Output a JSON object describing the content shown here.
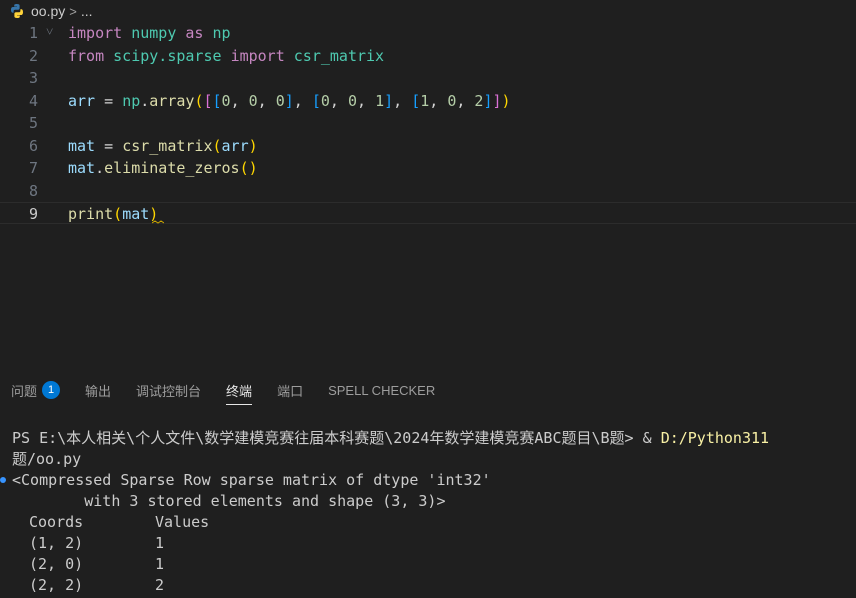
{
  "breadcrumb": {
    "file": "oo.py",
    "separator": ">",
    "more": "..."
  },
  "editor": {
    "line_numbers": [
      "1",
      "2",
      "3",
      "4",
      "5",
      "6",
      "7",
      "8",
      "9"
    ],
    "lines": [
      {
        "tokens": [
          [
            "kw",
            "import"
          ],
          [
            "op",
            " "
          ],
          [
            "mod",
            "numpy"
          ],
          [
            "op",
            " "
          ],
          [
            "kw",
            "as"
          ],
          [
            "op",
            " "
          ],
          [
            "mod",
            "np"
          ]
        ]
      },
      {
        "tokens": [
          [
            "kw",
            "from"
          ],
          [
            "op",
            " "
          ],
          [
            "mod",
            "scipy.sparse"
          ],
          [
            "op",
            " "
          ],
          [
            "kw",
            "import"
          ],
          [
            "op",
            " "
          ],
          [
            "mod",
            "csr_matrix"
          ]
        ]
      },
      {
        "tokens": []
      },
      {
        "tokens": [
          [
            "var",
            "arr"
          ],
          [
            "op",
            " = "
          ],
          [
            "mod",
            "np"
          ],
          [
            "op",
            "."
          ],
          [
            "fn",
            "array"
          ],
          [
            "b1",
            "("
          ],
          [
            "b2",
            "["
          ],
          [
            "b3",
            "["
          ],
          [
            "num",
            "0"
          ],
          [
            "op",
            ", "
          ],
          [
            "num",
            "0"
          ],
          [
            "op",
            ", "
          ],
          [
            "num",
            "0"
          ],
          [
            "b3",
            "]"
          ],
          [
            "op",
            ", "
          ],
          [
            "b3",
            "["
          ],
          [
            "num",
            "0"
          ],
          [
            "op",
            ", "
          ],
          [
            "num",
            "0"
          ],
          [
            "op",
            ", "
          ],
          [
            "num",
            "1"
          ],
          [
            "b3",
            "]"
          ],
          [
            "op",
            ", "
          ],
          [
            "b3",
            "["
          ],
          [
            "num",
            "1"
          ],
          [
            "op",
            ", "
          ],
          [
            "num",
            "0"
          ],
          [
            "op",
            ", "
          ],
          [
            "num",
            "2"
          ],
          [
            "b3",
            "]"
          ],
          [
            "b2",
            "]"
          ],
          [
            "b1",
            ")"
          ]
        ]
      },
      {
        "tokens": []
      },
      {
        "tokens": [
          [
            "var",
            "mat"
          ],
          [
            "op",
            " = "
          ],
          [
            "fn",
            "csr_matrix"
          ],
          [
            "b1",
            "("
          ],
          [
            "var",
            "arr"
          ],
          [
            "b1",
            ")"
          ]
        ]
      },
      {
        "tokens": [
          [
            "var",
            "mat"
          ],
          [
            "op",
            "."
          ],
          [
            "fn",
            "eliminate_zeros"
          ],
          [
            "b1",
            "()"
          ]
        ]
      },
      {
        "tokens": []
      },
      {
        "tokens": [
          [
            "fn",
            "print"
          ],
          [
            "b1",
            "("
          ],
          [
            "var",
            "mat"
          ],
          [
            "b1",
            ")"
          ]
        ]
      }
    ],
    "current_line": 9
  },
  "panel": {
    "tabs": [
      "问题",
      "输出",
      "调试控制台",
      "终端",
      "端口",
      "SPELL CHECKER"
    ],
    "active_tab": "终端",
    "problems_count": "1"
  },
  "terminal": {
    "prompt_prefix": "PS E:\\本人相关\\个人文件\\数学建模竞赛往届本科赛题\\2024年数学建模竞赛ABC题目\\B题> ",
    "command_amp": "& ",
    "command_path": "D:/Python311",
    "line2": "题/oo.py",
    "out1": "<Compressed Sparse Row sparse matrix of dtype 'int32'",
    "out2": "        with 3 stored elements and shape (3, 3)>",
    "header_coords": "Coords",
    "header_values": "Values",
    "rows": [
      {
        "coords": "(1, 2)",
        "value": "1"
      },
      {
        "coords": "(2, 0)",
        "value": "1"
      },
      {
        "coords": "(2, 2)",
        "value": "2"
      }
    ]
  },
  "colors": {
    "background": "#1f1f1f",
    "keyword": "#c586c0",
    "function": "#dcdcaa",
    "variable": "#9cdcfe",
    "number": "#b5cea8",
    "badge": "#0078d4"
  }
}
